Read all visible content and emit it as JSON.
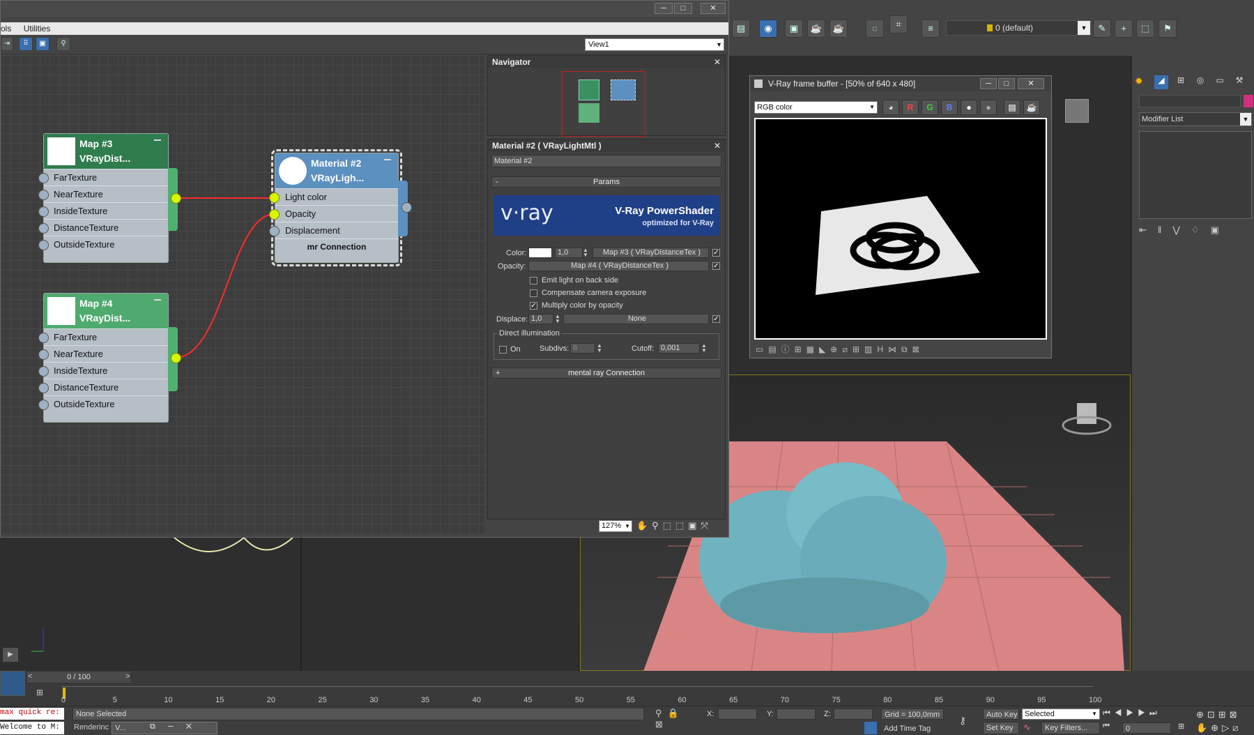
{
  "toolbar": {
    "layer_label": "0 (default)"
  },
  "slate": {
    "menu": [
      "ols",
      "Utilities"
    ],
    "view_select": "View1",
    "zoom": "127%"
  },
  "nodes": {
    "map3": {
      "title1": "Map #3",
      "title2": "VRayDist...",
      "ports": [
        "FarTexture",
        "NearTexture",
        "InsideTexture",
        "DistanceTexture",
        "OutsideTexture"
      ]
    },
    "map4": {
      "title1": "Map #4",
      "title2": "VRayDist...",
      "ports": [
        "FarTexture",
        "NearTexture",
        "InsideTexture",
        "DistanceTexture",
        "OutsideTexture"
      ]
    },
    "material2": {
      "title1": "Material #2",
      "title2": "VRayLigh...",
      "ports": [
        "Light color",
        "Opacity",
        "Displacement"
      ],
      "footer": "mr Connection"
    }
  },
  "navigator": {
    "title": "Navigator"
  },
  "params": {
    "panel_title": "Material #2  ( VRayLightMtl )",
    "name_value": "Material #2",
    "rollout_params": "Params",
    "banner_logo": "v·ray",
    "banner_title": "V-Ray PowerShader",
    "banner_sub": "optimized for V-Ray",
    "color_label": "Color:",
    "color_mult": "1,0",
    "color_map": "Map #3  ( VRayDistanceTex )",
    "opacity_label": "Opacity:",
    "opacity_map": "Map #4  ( VRayDistanceTex )",
    "emit_back": "Emit light on back side",
    "compensate": "Compensate camera exposure",
    "multiply": "Multiply color by opacity",
    "displace_label": "Displace:",
    "displace_val": "1,0",
    "displace_map": "None",
    "direct_group": "Direct illumination",
    "on_label": "On",
    "subdivs_label": "Subdivs:",
    "subdivs_val": "8",
    "cutoff_label": "Cutoff:",
    "cutoff_val": "0,001",
    "rollout_mr": "mental ray Connection"
  },
  "vfb": {
    "title": "V-Ray frame buffer - [50% of 640 x 480]",
    "channel": "RGB color",
    "r": "R",
    "g": "G",
    "b": "B"
  },
  "command_panel": {
    "modifier_list": "Modifier List"
  },
  "timeline": {
    "frame": "0 / 100",
    "ticks": [
      "0",
      "5",
      "10",
      "15",
      "20",
      "25",
      "30",
      "35",
      "40",
      "45",
      "50",
      "55",
      "60",
      "65",
      "70",
      "75",
      "80",
      "85",
      "90",
      "95",
      "100"
    ]
  },
  "status": {
    "script1": "max quick re:",
    "script2": "Welcome to M:",
    "selection": "None Selected",
    "rendering": "Renderinc",
    "x_label": "X:",
    "y_label": "Y:",
    "z_label": "Z:",
    "grid": "Grid = 100,0mm",
    "add_time_tag": "Add Time Tag",
    "auto_key": "Auto Key",
    "selected": "Selected",
    "set_key": "Set Key",
    "key_filters": "Key Filters...",
    "frame_field": "0",
    "mini_win": "V..."
  },
  "colors": {
    "accent_blue": "#3a6fb0",
    "map_node_green": "#2f8c52",
    "material_node_blue": "#5b90c0",
    "port_active": "#d9f500",
    "wire": "#ff2a2a",
    "plane_pink": "#d98585",
    "blob_teal": "#6fb3c0"
  }
}
